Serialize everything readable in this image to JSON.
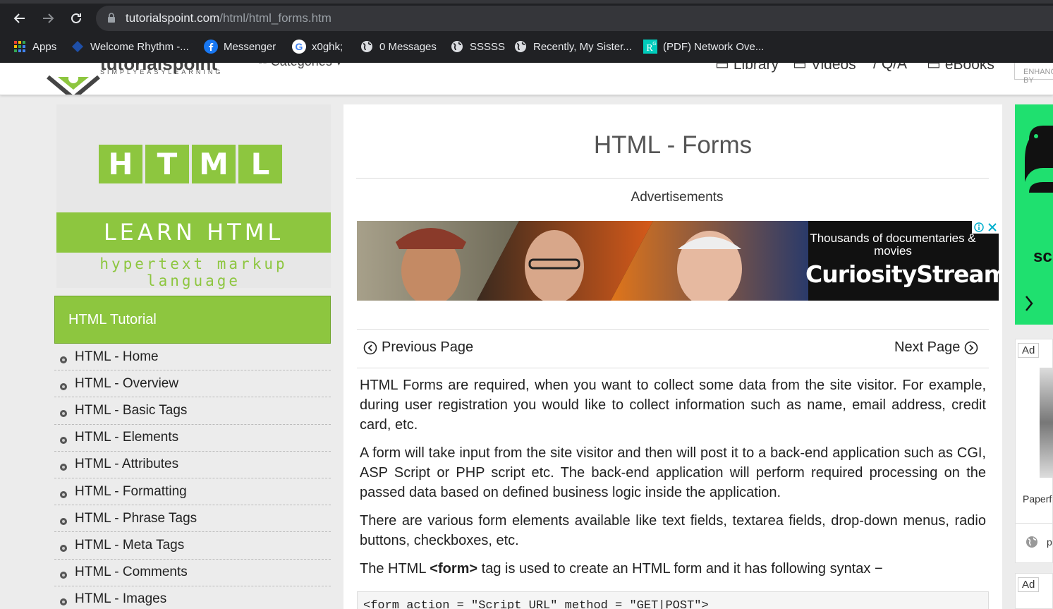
{
  "browser": {
    "url_domain": "tutorialspoint.com",
    "url_path": "/html/html_forms.htm",
    "bookmarks": [
      {
        "label": "Apps",
        "icon": "apps-grid-icon"
      },
      {
        "label": "Welcome Rhythm -...",
        "icon": "diamond-icon"
      },
      {
        "label": "Messenger",
        "icon": "facebook-icon"
      },
      {
        "label": "x0ghk;",
        "icon": "google-icon"
      },
      {
        "label": "0 Messages",
        "icon": "globe-icon"
      },
      {
        "label": "SSSSS",
        "icon": "globe-icon"
      },
      {
        "label": "Recently, My Sister...",
        "icon": "globe-icon"
      },
      {
        "label": "(PDF) Network Ove...",
        "icon": "researchgate-icon"
      }
    ]
  },
  "header": {
    "logo_text": "tutorialspoint",
    "logo_tagline": "SIMPLYEASYLEARNING",
    "categories_label": "Categories",
    "nav": [
      "Library",
      "Videos",
      "Q/A",
      "eBooks"
    ],
    "enhance_label": "ENHANCED BY"
  },
  "sidebar": {
    "banner": {
      "letters": [
        "H",
        "T",
        "M",
        "L"
      ],
      "learn": "LEARN HTML",
      "subtitle": "hypertext markup language"
    },
    "heading": "HTML Tutorial",
    "items": [
      "HTML - Home",
      "HTML - Overview",
      "HTML - Basic Tags",
      "HTML - Elements",
      "HTML - Attributes",
      "HTML - Formatting",
      "HTML - Phrase Tags",
      "HTML - Meta Tags",
      "HTML - Comments",
      "HTML - Images"
    ]
  },
  "main": {
    "title": "HTML - Forms",
    "advertisements_label": "Advertisements",
    "ad": {
      "tagline": "Thousands of documentaries & movies",
      "brand": "CuriosityStream"
    },
    "prev_label": "Previous Page",
    "next_label": "Next Page",
    "paragraphs": [
      "HTML Forms are required, when you want to collect some data from the site visitor. For example, during user registration you would like to collect information such as name, email address, credit card, etc.",
      "A form will take input from the site visitor and then will post it to a back-end application such as CGI, ASP Script or PHP script etc. The back-end application will perform required processing on the passed data based on defined business logic inside the application.",
      "There are various form elements available like text fields, textarea fields, drop-down menus, radio buttons, checkboxes, etc."
    ],
    "syntax_pre": "The HTML ",
    "syntax_tag": "<form>",
    "syntax_post": " tag is used to create an HTML form and it has following syntax −",
    "code_line": "<form action = \"Script URL\" method = \"GET|POST\">"
  },
  "right_ads": {
    "ad_tag": "Ad",
    "ad_tag2": "Ad",
    "ad1_text": "sc",
    "card_caption": "Paperf",
    "card_link": "p"
  },
  "colors": {
    "accent_green": "#8dc63f",
    "chrome_bg": "#202124",
    "ad_green": "#1fe06f"
  }
}
